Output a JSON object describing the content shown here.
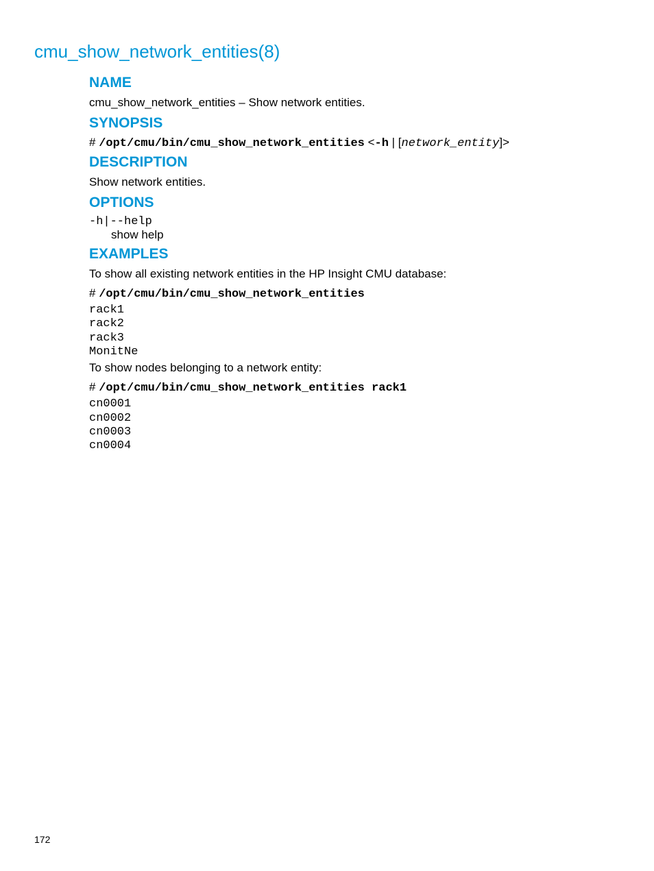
{
  "page": {
    "title": "cmu_show_network_entities(8)",
    "number": "172"
  },
  "sections": {
    "name": {
      "heading": "NAME",
      "text": "cmu_show_network_entities – Show network entities."
    },
    "synopsis": {
      "heading": "SYNOPSIS",
      "hash": "# ",
      "cmd": "/opt/cmu/bin/cmu_show_network_entities",
      "opt_open": " <",
      "flag": "-h",
      "pipe": " | [",
      "arg": "network_entity",
      "close": "]>"
    },
    "description": {
      "heading": "DESCRIPTION",
      "text": "Show network entities."
    },
    "options": {
      "heading": "OPTIONS",
      "flag": "-h|--help",
      "desc": "show help"
    },
    "examples": {
      "heading": "EXAMPLES",
      "intro1": "To show all existing network entities in the HP Insight CMU database:",
      "cmd1_hash": "# ",
      "cmd1": "/opt/cmu/bin/cmu_show_network_entities",
      "output1": "rack1\nrack2\nrack3\nMonitNe",
      "intro2": "To show nodes belonging to a network entity:",
      "cmd2_hash": "# ",
      "cmd2": "/opt/cmu/bin/cmu_show_network_entities rack1",
      "output2": "cn0001\ncn0002\ncn0003\ncn0004"
    }
  }
}
